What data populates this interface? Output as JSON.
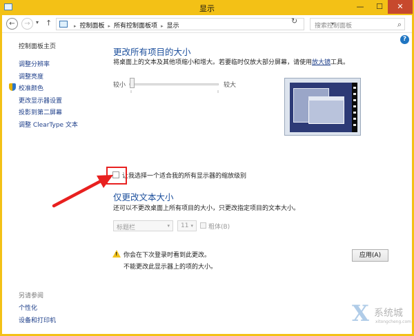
{
  "window": {
    "title": "显示",
    "min_glyph": "—",
    "max_glyph": "☐",
    "close_glyph": "✕"
  },
  "navigation": {
    "back_glyph": "←",
    "forward_glyph": "→",
    "dropdown_glyph": "▾",
    "up_glyph": "↑",
    "breadcrumbs": [
      "控制面板",
      "所有控制面板项",
      "显示"
    ],
    "breadcrumb_separator": "▸",
    "address_chevron": "▾",
    "refresh_glyph": "↻",
    "search_placeholder": "搜索控制面板",
    "search_glyph": "⌕"
  },
  "help": {
    "glyph": "?"
  },
  "sidebar": {
    "home": "控制面板主页",
    "links": [
      "调整分辨率",
      "调整亮度",
      "校准颜色",
      "更改显示器设置",
      "投影到第二屏幕",
      "调整 ClearType 文本"
    ],
    "see_also_title": "另请参阅",
    "see_also_links": [
      "个性化",
      "设备和打印机"
    ]
  },
  "main": {
    "change_all_title": "更改所有项目的大小",
    "change_all_desc_before": "将桌面上的文本及其他项缩小和增大。若要临时仅放大部分屏幕，请使用",
    "magnifier_link": "放大镜",
    "change_all_desc_after": "工具。",
    "slider_small": "较小",
    "slider_large": "较大",
    "slider_level_fraction": 0,
    "custom_scale_option": "让我选择一个适合我的所有显示器的缩放级别",
    "custom_scale_checked": false,
    "text_only_title": "仅更改文本大小",
    "text_only_desc": "还可以不更改桌面上所有项目的大小，只更改指定项目的文本大小。",
    "item_select_value": "标题栏",
    "size_select_value": "11",
    "select_caret": "▾",
    "bold_label": "粗体(B)",
    "bold_checked": false,
    "warning_glyph": "!",
    "warning_line1": "你会在下次登录时看到此更改。",
    "warning_line2": "不能更改此显示器上的项的大小。",
    "apply_button": "应用(A)"
  },
  "watermark": {
    "glyph": "X",
    "text": "系统城",
    "sub": "xitongcheng.com"
  },
  "colors": {
    "titlebar": "#f3c116",
    "heading_blue": "#1c4f9c",
    "link_blue": "#1e3f8a",
    "annotation_red": "#e8201f"
  }
}
